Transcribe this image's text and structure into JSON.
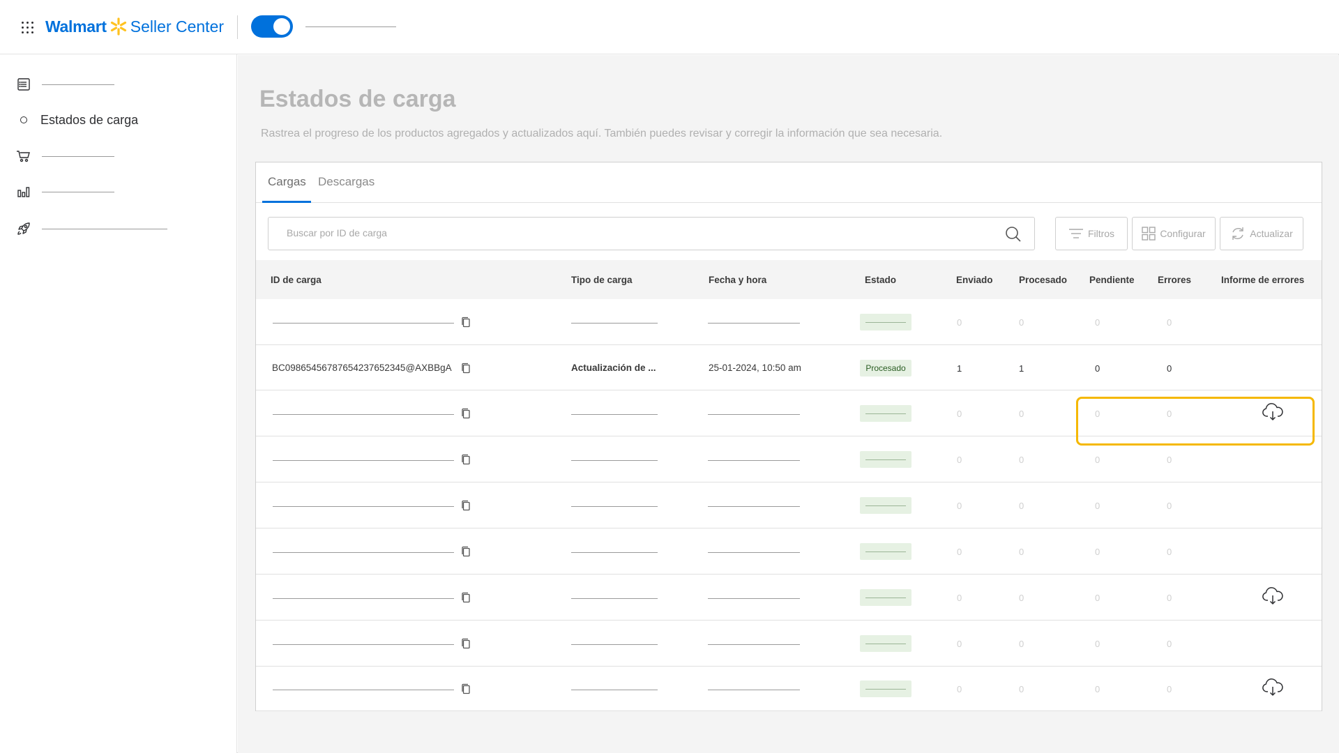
{
  "header": {
    "brand_walmart": "Walmart",
    "brand_seller": "Seller Center",
    "toggle_on": true,
    "spark_color": "#ffc220",
    "accent_color": "#0071dc"
  },
  "sidebar": {
    "items": [
      {
        "icon": "list-icon",
        "label": ""
      },
      {
        "icon": "circle-icon",
        "label": "Estados de carga"
      },
      {
        "icon": "cart-icon",
        "label": ""
      },
      {
        "icon": "bar-chart-icon",
        "label": ""
      },
      {
        "icon": "rocket-icon",
        "label": ""
      }
    ]
  },
  "main": {
    "title": "Estados de carga",
    "description": "Rastrea el progreso de los productos agregados y actualizados aquí. También puedes revisar y corregir la información que sea necesaria.",
    "tabs": [
      {
        "label": "Cargas",
        "active": true
      },
      {
        "label": "Descargas",
        "active": false
      }
    ],
    "search": {
      "placeholder": "Buscar por ID de carga",
      "value": ""
    },
    "buttons": {
      "filters": "Filtros",
      "configure": "Configurar",
      "refresh": "Actualizar"
    }
  },
  "table": {
    "columns": [
      "ID de carga",
      "Tipo de carga",
      "Fecha y hora",
      "Estado",
      "Enviado",
      "Procesado",
      "Pendiente",
      "Errores",
      "Informe de errores"
    ],
    "rows": [
      {
        "id": "",
        "type": "",
        "date": "",
        "status": "",
        "sent": "0",
        "processed": "0",
        "pending": "0",
        "errors": "0",
        "report": false
      },
      {
        "id": "BC0986545678765423765234​5@AXBBgA",
        "type": "Actualización de ...",
        "date": "25-01-2024, 10:50 am",
        "status": "Procesado",
        "sent": "1",
        "processed": "1",
        "pending": "0",
        "errors": "0",
        "report": false,
        "active": true
      },
      {
        "id": "",
        "type": "",
        "date": "",
        "status": "",
        "sent": "0",
        "processed": "0",
        "pending": "0",
        "errors": "0",
        "report": true
      },
      {
        "id": "",
        "type": "",
        "date": "",
        "status": "",
        "sent": "0",
        "processed": "0",
        "pending": "0",
        "errors": "0",
        "report": false
      },
      {
        "id": "",
        "type": "",
        "date": "",
        "status": "",
        "sent": "0",
        "processed": "0",
        "pending": "0",
        "errors": "0",
        "report": false
      },
      {
        "id": "",
        "type": "",
        "date": "",
        "status": "",
        "sent": "0",
        "processed": "0",
        "pending": "0",
        "errors": "0",
        "report": false
      },
      {
        "id": "",
        "type": "",
        "date": "",
        "status": "",
        "sent": "0",
        "processed": "0",
        "pending": "0",
        "errors": "0",
        "report": true
      },
      {
        "id": "",
        "type": "",
        "date": "",
        "status": "",
        "sent": "0",
        "processed": "0",
        "pending": "0",
        "errors": "0",
        "report": false
      },
      {
        "id": "",
        "type": "",
        "date": "",
        "status": "",
        "sent": "0",
        "processed": "0",
        "pending": "0",
        "errors": "0",
        "report": true
      }
    ]
  },
  "highlight_color": "#f5b800"
}
